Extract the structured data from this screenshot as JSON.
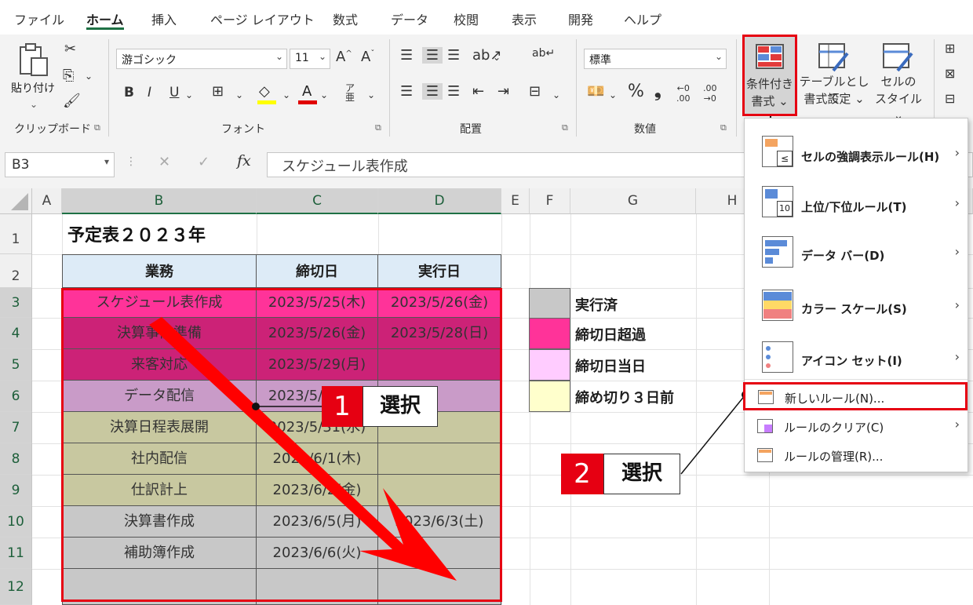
{
  "tabs": [
    "ファイル",
    "ホーム",
    "挿入",
    "ページ レイアウト",
    "数式",
    "データ",
    "校閲",
    "表示",
    "開発",
    "ヘルプ"
  ],
  "ribbon": {
    "clipboard": {
      "label": "クリップボード",
      "paste": "貼り付け"
    },
    "font": {
      "label": "フォント",
      "name": "游ゴシック",
      "size": "11",
      "bold": "B",
      "italic": "I",
      "underline": "U"
    },
    "alignment": {
      "label": "配置"
    },
    "number": {
      "label": "数値",
      "format": "標準",
      "percent": "%",
      "comma": "❟",
      "inc_decimal": ".00",
      "dec_decimal": ".00"
    },
    "styles": {
      "conditional_formatting": [
        "条件付き",
        "書式 ⌄"
      ],
      "format_as_table": [
        "テーブルとして",
        "書式設定 ⌄"
      ],
      "cell_styles": [
        "セルの",
        "スタイル ⌄"
      ]
    }
  },
  "formula_bar": {
    "name_box": "B3",
    "fx": "fx",
    "value": "スケジュール表作成"
  },
  "sheet": {
    "columns": [
      "A",
      "B",
      "C",
      "D",
      "E",
      "F",
      "G",
      "H"
    ],
    "rows": [
      "1",
      "2",
      "3",
      "4",
      "5",
      "6",
      "7",
      "8",
      "9",
      "10",
      "11",
      "12"
    ],
    "title": "予定表２０２３年",
    "headers": [
      "業務",
      "締切日",
      "実行日"
    ],
    "data": [
      [
        "スケジュール表作成",
        "2023/5/25(木)",
        "2023/5/26(金)"
      ],
      [
        "決算事前準備",
        "2023/5/26(金)",
        "2023/5/28(日)"
      ],
      [
        "来客対応",
        "2023/5/29(月)",
        ""
      ],
      [
        "データ配信",
        "2023/5/30(火)",
        ""
      ],
      [
        "決算日程表展開",
        "2023/5/31(水)",
        ""
      ],
      [
        "社内配信",
        "2023/6/1(木)",
        ""
      ],
      [
        "仕訳計上",
        "2023/6/2(金)",
        ""
      ],
      [
        "決算書作成",
        "2023/6/5(月)",
        "2023/6/3(土)"
      ],
      [
        "補助簿作成",
        "2023/6/6(火)",
        ""
      ],
      [
        "",
        "",
        ""
      ]
    ],
    "row_colors": [
      "#ff3399",
      "#cc2277",
      "#cc2277",
      "#c99bc8",
      "#c8c8a0",
      "#c8c8a0",
      "#c8c8a0",
      "#c8c8c8",
      "#c8c8c8",
      "#c8c8c8"
    ],
    "legend": [
      {
        "label": "実行済",
        "color": "#c8c8c8"
      },
      {
        "label": "締切日超過",
        "color": "#ff3399"
      },
      {
        "label": "締切日当日",
        "color": "#ffccff"
      },
      {
        "label": "締め切り３日前",
        "color": "#ffffcc"
      }
    ]
  },
  "cf_menu": {
    "items": [
      {
        "label": "セルの強調表示ルール(H)",
        "icon": "highlight-rules-icon"
      },
      {
        "label": "上位/下位ルール(T)",
        "icon": "top-bottom-rules-icon"
      },
      {
        "label": "データ バー(D)",
        "icon": "data-bars-icon"
      },
      {
        "label": "カラー スケール(S)",
        "icon": "color-scales-icon"
      },
      {
        "label": "アイコン セット(I)",
        "icon": "icon-sets-icon"
      }
    ],
    "small_items": [
      {
        "label": "新しいルール(N)...",
        "icon": "new-rule-icon"
      },
      {
        "label": "ルールのクリア(C)",
        "icon": "clear-rules-icon"
      },
      {
        "label": "ルールの管理(R)...",
        "icon": "manage-rules-icon"
      }
    ]
  },
  "callouts": [
    {
      "num": "1",
      "text": "選択"
    },
    {
      "num": "2",
      "text": "選択"
    }
  ],
  "colors": {
    "accent": "#1e7145",
    "highlight_red": "#e60012"
  }
}
